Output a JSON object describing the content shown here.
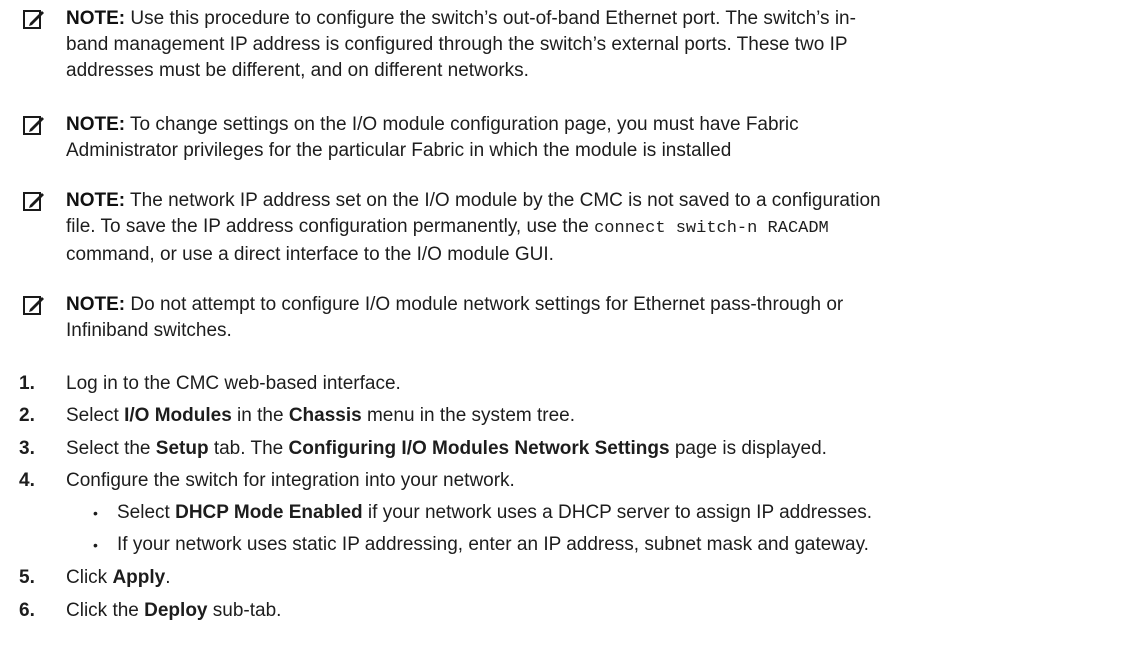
{
  "notes": [
    {
      "label": "NOTE:",
      "lines": [
        " Use this procedure to configure the switch’s out-of-band Ethernet port. The switch’s in-",
        "band management IP address is configured through the switch’s external ports. These two IP",
        "addresses must be different, and on different networks."
      ]
    },
    {
      "label": "NOTE:",
      "lines": [
        " To change settings on the I/O module configuration page, you must have Fabric",
        "Administrator privileges for the particular Fabric in which the module is installed"
      ]
    },
    {
      "label": "NOTE:",
      "line1": " The network IP address set on the I/O module by the CMC is not saved to a configuration",
      "line2_pre": "file. To save the IP address configuration permanently, use the ",
      "line2_code": "connect switch-n RACADM",
      "line3": "command, or use a direct interface to the I/O module GUI."
    },
    {
      "label": "NOTE:",
      "lines": [
        " Do not attempt to configure I/O module network settings for Ethernet pass-through or",
        "Infiniband switches."
      ]
    }
  ],
  "steps": [
    {
      "num": "1.",
      "text": "Log in to the CMC web-based interface."
    },
    {
      "num": "2.",
      "pre": "Select ",
      "b1": "I/O Modules",
      "mid": " in the ",
      "b2": "Chassis",
      "post": " menu in the system tree."
    },
    {
      "num": "3.",
      "pre": "Select the ",
      "b1": "Setup",
      "mid": " tab. The ",
      "b2": "Configuring I/O Modules Network Settings",
      "post": " page is displayed."
    },
    {
      "num": "4.",
      "text": "Configure the switch for integration into your network."
    },
    {
      "num": "5.",
      "pre": "Click ",
      "b1": "Apply",
      "post": "."
    },
    {
      "num": "6.",
      "pre": "Click the ",
      "b1": "Deploy",
      "post": " sub-tab."
    }
  ],
  "substeps": [
    {
      "bullet": "•",
      "pre": "Select ",
      "b1": "DHCP Mode Enabled",
      "post": " if your network uses a DHCP server to assign IP addresses."
    },
    {
      "bullet": "•",
      "text": "If your network uses static IP addressing, enter an IP address, subnet mask and gateway."
    }
  ]
}
